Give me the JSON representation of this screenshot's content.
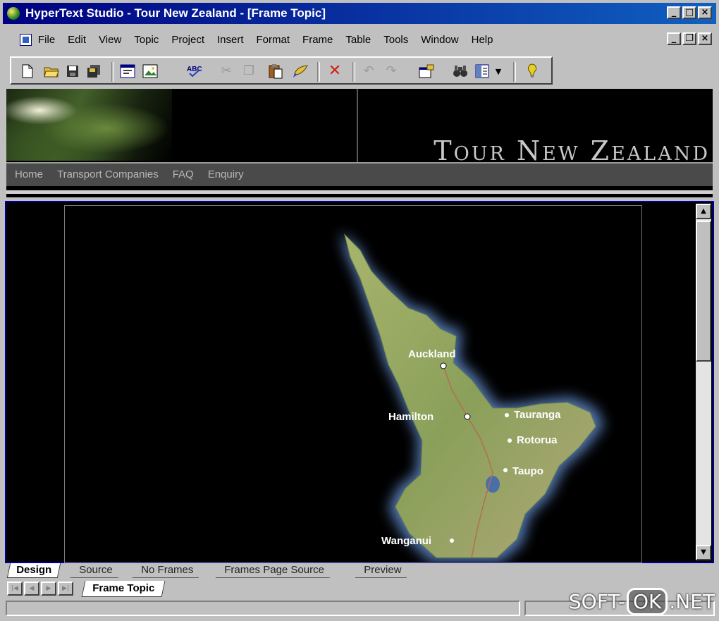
{
  "window": {
    "title": "HyperText Studio - Tour New Zealand - [Frame Topic]",
    "controls": {
      "minimize": "_",
      "maximize": "□",
      "close": "×"
    }
  },
  "menu": {
    "items": [
      "File",
      "Edit",
      "View",
      "Topic",
      "Project",
      "Insert",
      "Format",
      "Frame",
      "Table",
      "Tools",
      "Window",
      "Help"
    ],
    "mdi_controls": {
      "minimize": "_",
      "restore": "❐",
      "close": "×"
    }
  },
  "toolbar": {
    "icons": [
      "new-document-icon",
      "open-folder-icon",
      "save-icon",
      "save-all-icon",
      "topic-properties-icon",
      "insert-picture-icon",
      "spell-check-icon",
      "cut-icon",
      "copy-icon",
      "paste-icon",
      "format-painter-icon",
      "delete-icon",
      "undo-icon",
      "redo-icon",
      "properties-icon",
      "find-icon",
      "view-menu-icon",
      "help-icon"
    ]
  },
  "banner": {
    "brand": "Tour New Zealand",
    "nav": [
      "Home",
      "Transport Companies",
      "FAQ",
      "Enquiry"
    ]
  },
  "map": {
    "cities": [
      {
        "name": "Auckland"
      },
      {
        "name": "Hamilton"
      },
      {
        "name": "Tauranga"
      },
      {
        "name": "Rotorua"
      },
      {
        "name": "Taupo"
      },
      {
        "name": "Wanganui"
      }
    ]
  },
  "view_tabs": [
    "Design",
    "Source",
    "No Frames",
    "Frames Page Source",
    "Preview"
  ],
  "active_view_tab": "Design",
  "frame_tabs": [
    "Frame Topic"
  ],
  "watermark": {
    "left": "SOFT-",
    "boxed": "OK",
    "right": ".NET"
  },
  "colors": {
    "titlebar_start": "#000080",
    "titlebar_end": "#1060c0",
    "chrome": "#c0c0c0",
    "banner_bg": "#000000"
  }
}
